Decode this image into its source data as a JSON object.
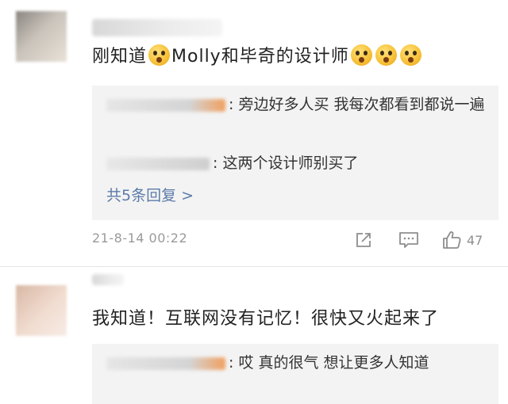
{
  "comments": [
    {
      "content_before": "刚知道",
      "content_mid": "Molly和毕奇的设计师",
      "replies": [
        {
          "text": ": 旁边好多人买 我每次都看到都说一遍"
        },
        {
          "text": ": 这两个设计师别买了"
        }
      ],
      "more_replies": "共5条回复 >",
      "timestamp": "21-8-14 00:22",
      "likes": "47"
    },
    {
      "content": "我知道！互联网没有记忆！很快又火起来了",
      "replies": [
        {
          "text": ": 哎 真的很气  想让更多人知道"
        }
      ]
    }
  ],
  "icons": {
    "share": "share-icon",
    "comment": "comment-icon",
    "like": "thumbs-up-icon",
    "emoji": "astonished-face-emoji"
  },
  "colors": {
    "link": "#5b7ba8",
    "reply_bg": "#f3f3f3",
    "muted": "#9a9a9a"
  }
}
